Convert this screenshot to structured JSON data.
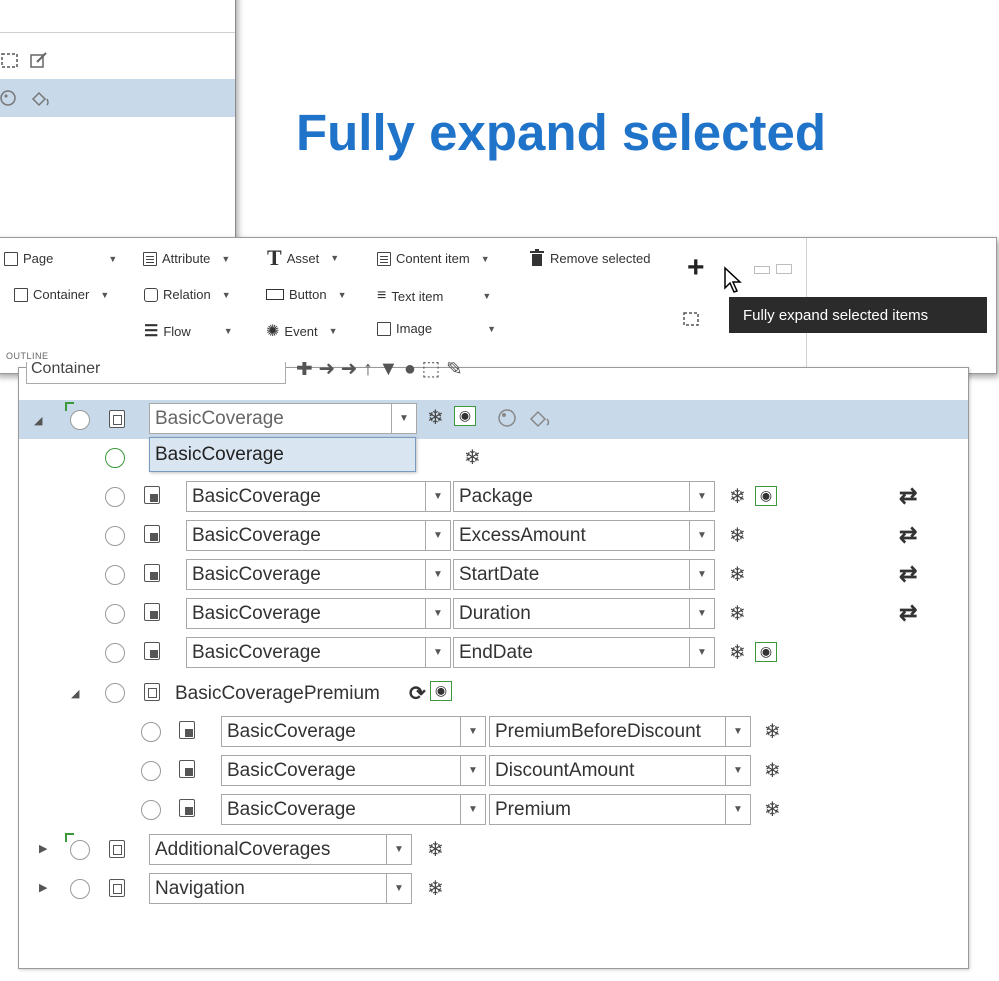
{
  "headline": "Fully expand selected",
  "ribbon": {
    "page_label": "Page",
    "attribute_label": "Attribute",
    "asset_label": "Asset",
    "content_item_label": "Content item",
    "remove_selected_label": "Remove selected",
    "container_label": "Container",
    "relation_label": "Relation",
    "button_label": "Button",
    "text_item_label": "Text item",
    "flow_label": "Flow",
    "event_label": "Event",
    "image_label": "Image",
    "section_label": "OUTLINE",
    "tooltip": "Fully expand selected items"
  },
  "tree": {
    "type_select": "Container",
    "popup_value": "BasicCoverage",
    "rows": [
      {
        "name": "BasicCoverage",
        "type": "container"
      },
      {
        "name": "BasicCoverage",
        "attribute": "Package"
      },
      {
        "name": "BasicCoverage",
        "attribute": "ExcessAmount"
      },
      {
        "name": "BasicCoverage",
        "attribute": "StartDate"
      },
      {
        "name": "BasicCoverage",
        "attribute": "Duration"
      },
      {
        "name": "BasicCoverage",
        "attribute": "EndDate"
      },
      {
        "name": "BasicCoveragePremium",
        "type": "container"
      },
      {
        "name": "BasicCoverage",
        "attribute": "PremiumBeforeDiscount"
      },
      {
        "name": "BasicCoverage",
        "attribute": "DiscountAmount"
      },
      {
        "name": "BasicCoverage",
        "attribute": "Premium"
      },
      {
        "name": "AdditionalCoverages",
        "type": "container"
      },
      {
        "name": "Navigation",
        "type": "container"
      }
    ]
  }
}
